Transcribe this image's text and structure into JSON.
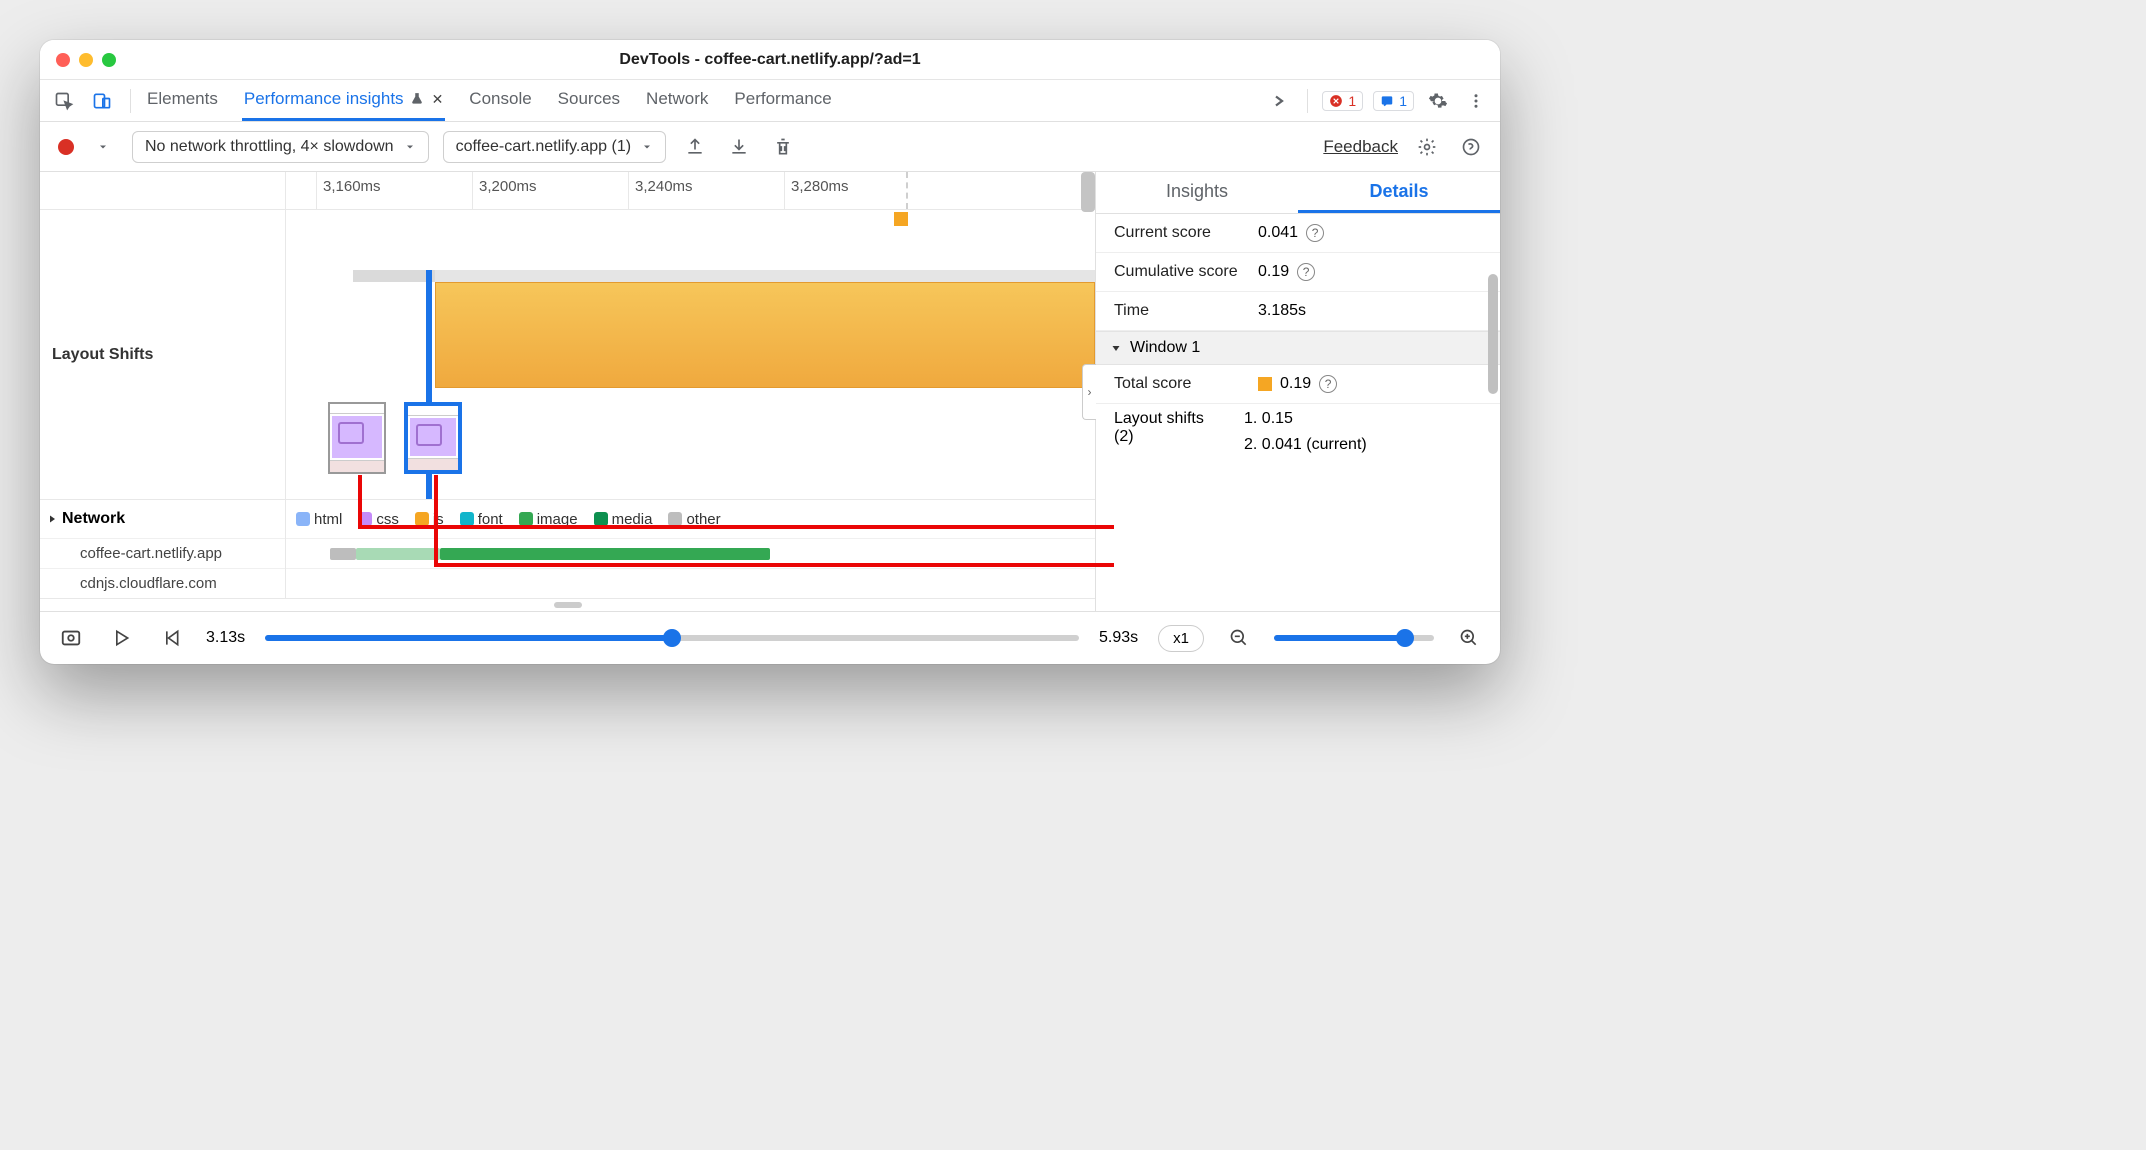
{
  "window": {
    "title": "DevTools - coffee-cart.netlify.app/?ad=1"
  },
  "tabs": {
    "items": [
      "Elements",
      "Performance insights",
      "Console",
      "Sources",
      "Network",
      "Performance"
    ],
    "activeIndex": 1,
    "errorCount": "1",
    "msgCount": "1"
  },
  "toolbar": {
    "throttling": "No network throttling, 4× slowdown",
    "recording": "coffee-cart.netlify.app (1)",
    "feedback": "Feedback"
  },
  "ruler": {
    "ticks": [
      "3,160ms",
      "3,200ms",
      "3,240ms",
      "3,280ms"
    ]
  },
  "lanes": {
    "layoutShifts": "Layout Shifts",
    "network": "Network",
    "hosts": [
      "coffee-cart.netlify.app",
      "cdnjs.cloudflare.com"
    ]
  },
  "legend": {
    "items": [
      {
        "label": "html",
        "color": "#8ab4f8"
      },
      {
        "label": "css",
        "color": "#c58af9"
      },
      {
        "label": "js",
        "color": "#f5a623"
      },
      {
        "label": "font",
        "color": "#12b5cb"
      },
      {
        "label": "image",
        "color": "#34a853"
      },
      {
        "label": "media",
        "color": "#0d904f"
      },
      {
        "label": "other",
        "color": "#bdbdbd"
      }
    ]
  },
  "details": {
    "tabs": [
      "Insights",
      "Details"
    ],
    "activeIndex": 1,
    "currentScoreLabel": "Current score",
    "currentScore": "0.041",
    "cumulativeLabel": "Cumulative score",
    "cumulative": "0.19",
    "timeLabel": "Time",
    "time": "3.185s",
    "windowLabel": "Window 1",
    "totalScoreLabel": "Total score",
    "totalScore": "0.19",
    "shiftsLabel": "Layout shifts (2)",
    "shifts": [
      "1. 0.15",
      "2. 0.041 (current)"
    ]
  },
  "footer": {
    "start": "3.13s",
    "end": "5.93s",
    "speed": "x1"
  },
  "colors": {
    "accent": "#1a73e8",
    "js": "#f5a623",
    "image": "#34a853",
    "imageLight": "#a8dab5",
    "error": "#d93025"
  }
}
